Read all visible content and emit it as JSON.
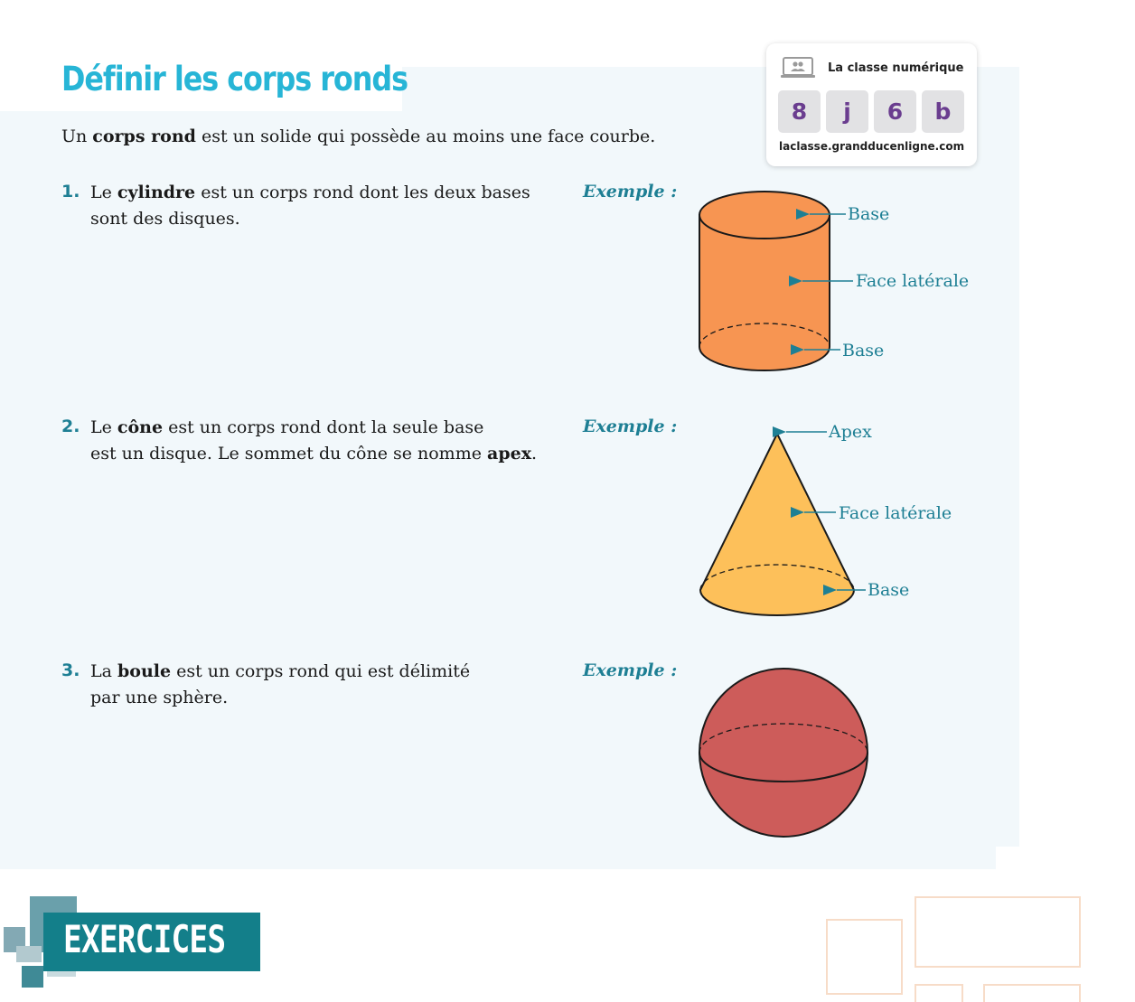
{
  "header": {
    "title": "Définir les corps ronds"
  },
  "intro": {
    "before": "Un ",
    "bold": "corps rond",
    "after": " est un solide qui possède au moins une face courbe."
  },
  "badge": {
    "title": "La classe numérique",
    "code": [
      "8",
      "j",
      "6",
      "b"
    ],
    "url": "laclasse.grandducenligne.com",
    "icon": "screen-users-icon"
  },
  "items": [
    {
      "number": "1.",
      "line1_before": "Le ",
      "line1_bold": "cylindre",
      "line1_after": " est un corps rond dont les deux bases",
      "line2": "sont des disques.",
      "exemple": "Exemple :",
      "labels": [
        "Base",
        "Face latérale",
        "Base"
      ]
    },
    {
      "number": "2.",
      "line1_before": "Le ",
      "line1_bold": "cône",
      "line1_after": " est un corps rond dont la seule base",
      "line2_before": "est un disque. Le sommet du cône se nomme ",
      "line2_bold": "apex",
      "line2_after": ".",
      "exemple": "Exemple :",
      "labels": [
        "Apex",
        "Face latérale",
        "Base"
      ]
    },
    {
      "number": "3.",
      "line1_before": "La ",
      "line1_bold": "boule",
      "line1_after": " est un corps rond qui est délimité",
      "line2": "par une sphère.",
      "exemple": "Exemple :"
    }
  ],
  "footer": {
    "exercices": "EXERCICES"
  },
  "colors": {
    "title": "#27b5d6",
    "teal": "#1e7f94",
    "cylinder": "#f79552",
    "cone": "#fdc05a",
    "sphere": "#cd5c5a",
    "code_text": "#6a3d8f",
    "exercices_band": "#137f8a"
  }
}
